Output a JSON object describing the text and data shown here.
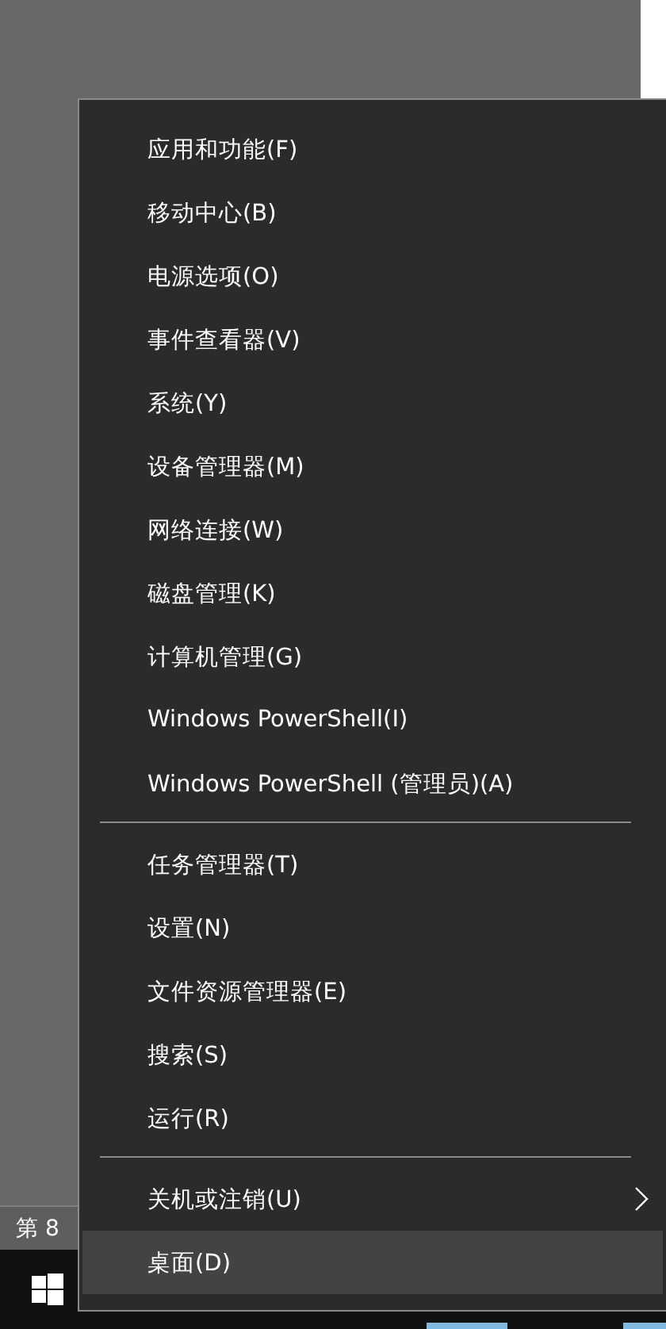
{
  "status_bar": {
    "text": "第 8"
  },
  "context_menu": {
    "groups": [
      {
        "items": [
          {
            "label": "应用和功能(F)",
            "submenu": false,
            "selected": false
          },
          {
            "label": "移动中心(B)",
            "submenu": false,
            "selected": false
          },
          {
            "label": "电源选项(O)",
            "submenu": false,
            "selected": false
          },
          {
            "label": "事件查看器(V)",
            "submenu": false,
            "selected": false
          },
          {
            "label": "系统(Y)",
            "submenu": false,
            "selected": false
          },
          {
            "label": "设备管理器(M)",
            "submenu": false,
            "selected": false
          },
          {
            "label": "网络连接(W)",
            "submenu": false,
            "selected": false
          },
          {
            "label": "磁盘管理(K)",
            "submenu": false,
            "selected": false
          },
          {
            "label": "计算机管理(G)",
            "submenu": false,
            "selected": false
          },
          {
            "label": "Windows PowerShell(I)",
            "submenu": false,
            "selected": false
          },
          {
            "label": "Windows PowerShell (管理员)(A)",
            "submenu": false,
            "selected": false
          }
        ]
      },
      {
        "items": [
          {
            "label": "任务管理器(T)",
            "submenu": false,
            "selected": false
          },
          {
            "label": "设置(N)",
            "submenu": false,
            "selected": false
          },
          {
            "label": "文件资源管理器(E)",
            "submenu": false,
            "selected": false
          },
          {
            "label": "搜索(S)",
            "submenu": false,
            "selected": false
          },
          {
            "label": "运行(R)",
            "submenu": false,
            "selected": false
          }
        ]
      },
      {
        "items": [
          {
            "label": "关机或注销(U)",
            "submenu": true,
            "selected": false
          },
          {
            "label": "桌面(D)",
            "submenu": false,
            "selected": true
          }
        ]
      }
    ]
  }
}
